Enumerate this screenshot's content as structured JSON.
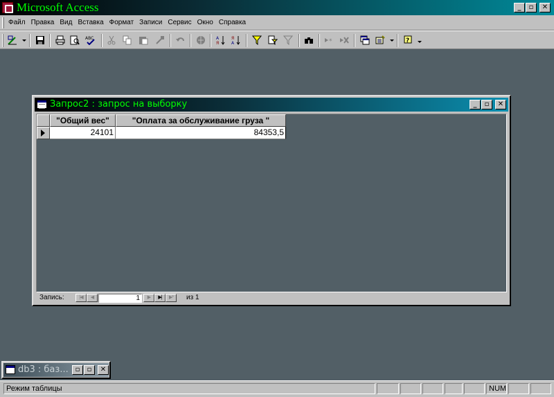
{
  "app": {
    "title": "Microsoft Access",
    "controls": {
      "minimize": "_",
      "maximize": "▫",
      "close": "✕"
    }
  },
  "menu": {
    "items": [
      "Файл",
      "Правка",
      "Вид",
      "Вставка",
      "Формат",
      "Записи",
      "Сервис",
      "Окно",
      "Справка"
    ]
  },
  "toolbar": {
    "icons": [
      "design-view-icon",
      "save-icon",
      "print-icon",
      "print-preview-icon",
      "spelling-icon",
      "cut-icon",
      "copy-icon",
      "paste-icon",
      "format-painter-icon",
      "undo-icon",
      "hyperlink-icon",
      "sort-ascending-icon",
      "sort-descending-icon",
      "filter-by-selection-icon",
      "filter-by-form-icon",
      "apply-filter-icon",
      "find-icon",
      "new-record-icon",
      "delete-record-icon",
      "database-window-icon",
      "new-object-icon",
      "help-icon"
    ]
  },
  "query_window": {
    "title": "Запрос2 : запрос на выборку",
    "columns": [
      "\"Общий вес\"",
      "\"Оплата за обслуживание груза \""
    ],
    "rows": [
      [
        "24101",
        "84353,5"
      ]
    ],
    "navigator": {
      "label": "Запись:",
      "current": "1",
      "of_label": "из",
      "total": "1",
      "buttons": {
        "first": "|◀",
        "prev": "◀",
        "next": "▶",
        "last": "▶|",
        "new": "▶*"
      }
    }
  },
  "minimized_window": {
    "title": "db3 : баз..."
  },
  "statusbar": {
    "mode": "Режим таблицы",
    "num": "NUM"
  },
  "colors": {
    "workspace": "#525f66",
    "caption_text": "#00ff00",
    "face": "#c0c0c0"
  }
}
